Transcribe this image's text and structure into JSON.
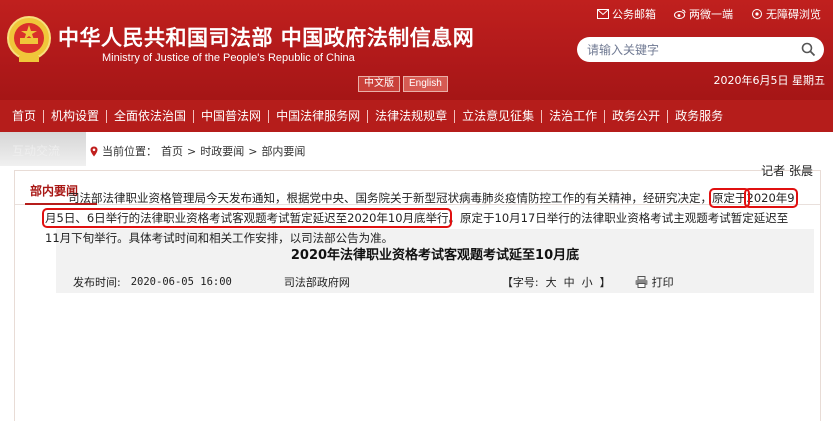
{
  "header": {
    "title": "中华人民共和国司法部  中国政府法制信息网",
    "subtitle": "Ministry of Justice of the People's Republic of China",
    "lang_zh": "中文版",
    "lang_en": "English",
    "links": [
      {
        "label": "公务邮箱",
        "icon": "mail-icon"
      },
      {
        "label": "两微一端",
        "icon": "weibo-icon"
      },
      {
        "label": "无障碍浏览",
        "icon": "accessibility-icon"
      }
    ],
    "search_placeholder": "请输入关键字",
    "date": "2020年6月5日  星期五"
  },
  "nav": [
    "首页",
    "机构设置",
    "全面依法治国",
    "中国普法网",
    "中国法律服务网",
    "法律法规规章",
    "立法意见征集",
    "法治工作",
    "政务公开",
    "政务服务"
  ],
  "breadcrumb": {
    "tab": "互动交流",
    "prefix": "当前位置：",
    "items": [
      "首页",
      "时政要闻",
      "部内要闻"
    ],
    "sep": ">"
  },
  "section": {
    "title": "部内要闻"
  },
  "article": {
    "title": "2020年法律职业资格考试客观题考试延至10月底",
    "date_label": "发布时间:",
    "date": "2020-06-05 16:00",
    "source": "司法部政府网",
    "font_label": "【字号:",
    "font_sizes": [
      "大",
      "中",
      "小"
    ],
    "font_close": "】",
    "print": "打印",
    "reporter": "记者 张晨",
    "para_a": "司法部法律职业资格管理局今天发布通知，根据党中央、国务院关于新型冠状病毒肺炎疫情防控工作的有关精神，经研究决定，",
    "para_hl1": "原定于",
    "para_hl2": "2020年9月5日、6日举行的法律职业资格考试客观题考试暂定延迟至2020年10月底举行",
    "para_b": "。原定于10月17日举行的法律职业资格考试主观题考试暂定延迟至11月下旬举行。具体考试时间和相关工作安排，以司法部公告为准。"
  },
  "colors": {
    "brand_red": "#b51d1b",
    "highlight_red": "#e01010"
  }
}
